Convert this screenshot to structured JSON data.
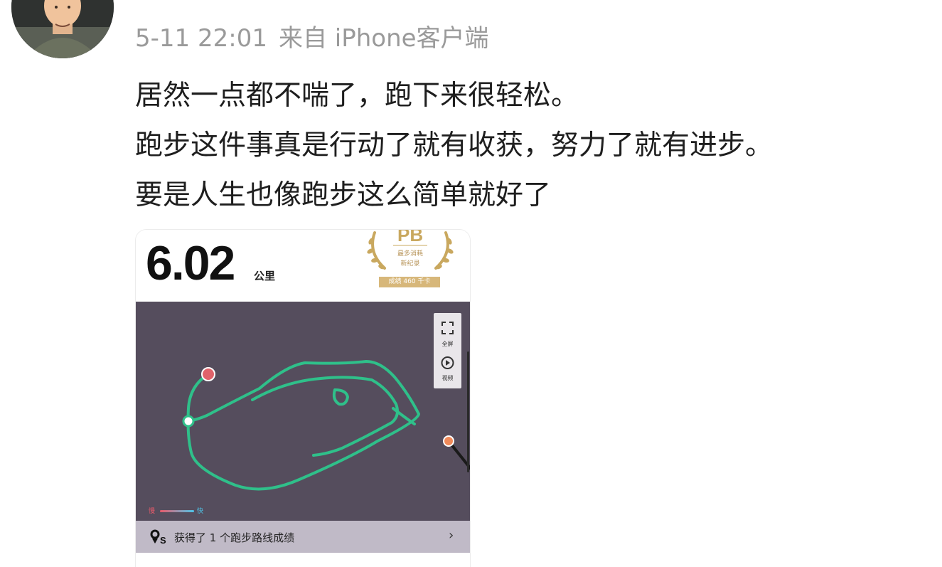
{
  "post": {
    "date": "5-11 22:01",
    "source": "来自 iPhone客户端",
    "lines": [
      "居然一点都不喘了，跑下来很轻松。",
      "跑步这件事真是行动了就有收获，努力了就有进步。",
      "要是人生也像跑步这么简单就好了"
    ]
  },
  "card": {
    "distance_value": "6.02",
    "distance_unit": "公里",
    "pb": {
      "letters": "PB",
      "subtitle_1": "最多消耗",
      "subtitle_2": "新纪录",
      "tag": "成绩 460 千卡"
    },
    "map_controls": {
      "fullscreen_label": "全屏",
      "video_label": "视频"
    },
    "legend": {
      "slow": "慢",
      "fast": "快"
    },
    "route_achievement": "获得了 1 个跑步路线成绩",
    "colors": {
      "map_bg": "#554d5d",
      "route": "#2fc08a",
      "start": "#2fc08a",
      "end": "#e0626a",
      "route_bar": "#c0bac7",
      "pb_gold": "#c9a85f"
    }
  }
}
